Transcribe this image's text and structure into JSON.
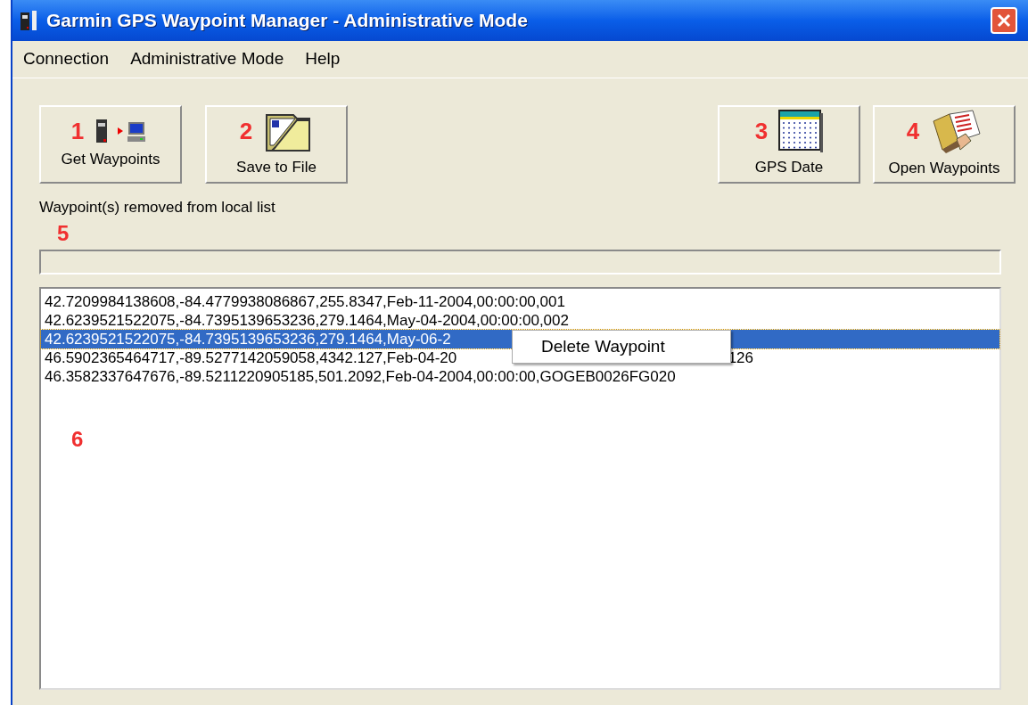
{
  "window": {
    "title": "Garmin GPS Waypoint Manager - Administrative Mode"
  },
  "menu": [
    "Connection",
    "Administrative Mode",
    "Help"
  ],
  "toolbar_left": [
    {
      "label": "Get Waypoints",
      "marker": "1",
      "kind": "transfer"
    },
    {
      "label": "Save to File",
      "marker": "2",
      "kind": "folder"
    }
  ],
  "toolbar_right": [
    {
      "label": "GPS Date",
      "marker": "3",
      "kind": "calendar"
    },
    {
      "label": "Open Waypoints",
      "marker": "4",
      "kind": "open"
    }
  ],
  "status": {
    "text": "Waypoint(s) removed from local list",
    "marker": "5"
  },
  "progress": {
    "level": 0
  },
  "list": {
    "marker": "6",
    "rows": [
      {
        "text": "42.7209984138608,-84.4779938086867,255.8347,Feb-11-2004,00:00:00,001",
        "selected": false
      },
      {
        "text": "42.6239521522075,-84.7395139653236,279.1464,May-04-2004,00:00:00,002",
        "selected": false
      },
      {
        "text": "42.6239521522075,-84.7395139653236,279.1464,May-06-2",
        "selected": true
      },
      {
        "text": "46.5902365464717,-89.5277142059058,4342.127,Feb-04-20",
        "tail": "126",
        "selected": false
      },
      {
        "text": "46.3582337647676,-89.5211220905185,501.2092,Feb-04-2004,00:00:00,GOGEB0026FG020",
        "selected": false
      }
    ]
  },
  "context_menu": {
    "items": [
      "Delete Waypoint"
    ]
  }
}
